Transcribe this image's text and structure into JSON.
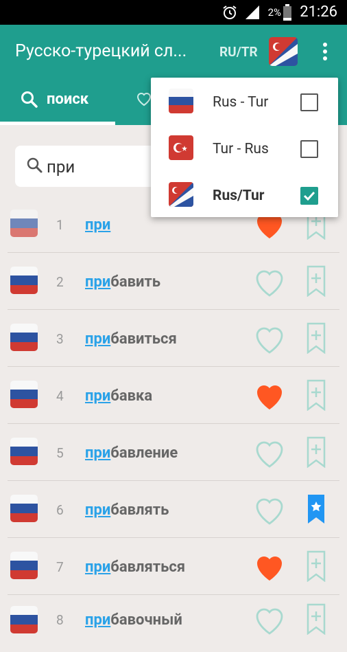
{
  "status_bar": {
    "battery_percent": "2%",
    "time": "21:26"
  },
  "app_bar": {
    "title": "Русско-турецкий сл...",
    "language_code": "RU/TR",
    "overflow_menu_icon": "more-vert-icon"
  },
  "tabs": {
    "search_label": "поиск"
  },
  "search": {
    "query": "при"
  },
  "language_menu": [
    {
      "label": "Rus - Tur",
      "checked": false
    },
    {
      "label": "Tur - Rus",
      "checked": false
    },
    {
      "label": "Rus/Tur",
      "checked": true
    }
  ],
  "results": [
    {
      "number": "1",
      "match": "при",
      "rest": "",
      "favorite": true,
      "bookmarked": false
    },
    {
      "number": "2",
      "match": "при",
      "rest": "бавить",
      "favorite": false,
      "bookmarked": false
    },
    {
      "number": "3",
      "match": "при",
      "rest": "бавиться",
      "favorite": false,
      "bookmarked": false
    },
    {
      "number": "4",
      "match": "при",
      "rest": "бавка",
      "favorite": true,
      "bookmarked": false
    },
    {
      "number": "5",
      "match": "при",
      "rest": "бавление",
      "favorite": false,
      "bookmarked": false
    },
    {
      "number": "6",
      "match": "при",
      "rest": "бавлять",
      "favorite": false,
      "bookmarked": true
    },
    {
      "number": "7",
      "match": "при",
      "rest": "бавляться",
      "favorite": true,
      "bookmarked": false
    },
    {
      "number": "8",
      "match": "при",
      "rest": "бавочный",
      "favorite": false,
      "bookmarked": false
    }
  ],
  "colors": {
    "primary": "#1f9e8e",
    "accent_heart": "#ff5722",
    "highlight": "#2aa2e8",
    "bookmark_active": "#2196f3"
  }
}
